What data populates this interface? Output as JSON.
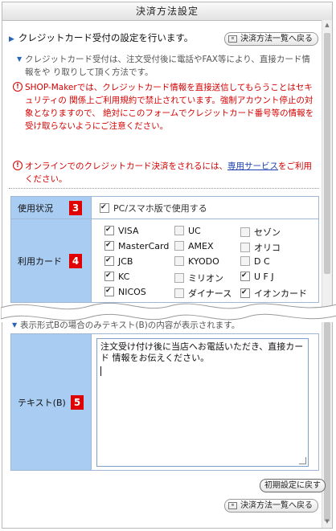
{
  "window": {
    "title": "決済方法設定"
  },
  "header": {
    "text": "クレジットカード受付の設定を行います。",
    "back_button_top": "決済方法一覧へ戻る"
  },
  "notes": {
    "info": "クレジットカード受付は、注文受付後に電話やFAX等により、直接カード情報をや り取りして頂く方法です。",
    "warning1": "SHOP-Makerでは、クレジットカード情報を直接送信してもらうことはセキュリティの 関係上ご利用規約で禁止されています。強制アカウント停止の対象となりますので、 絶対にこのフォームでクレジットカード番号等の情報を受け取らないようにご注意ください。",
    "warning2_prefix": "オンラインでのクレジットカード決済をされるには、",
    "warning2_link": "専用サービス",
    "warning2_suffix": "をご利用ください。"
  },
  "usage": {
    "label": "使用状況",
    "badge": "3",
    "checkbox_label": "PC/スマホ版で使用する",
    "checked": true
  },
  "cards": {
    "label": "利用カード",
    "badge": "4",
    "items": [
      {
        "name": "VISA",
        "checked": true
      },
      {
        "name": "UC",
        "checked": false
      },
      {
        "name": "セゾン",
        "checked": false
      },
      {
        "name": "MasterCard",
        "checked": true
      },
      {
        "name": "AMEX",
        "checked": false
      },
      {
        "name": "オリコ",
        "checked": false
      },
      {
        "name": "JCB",
        "checked": true
      },
      {
        "name": "KYODO",
        "checked": false
      },
      {
        "name": "D C",
        "checked": false
      },
      {
        "name": "KC",
        "checked": true
      },
      {
        "name": "ミリオン",
        "checked": false
      },
      {
        "name": "U F J",
        "checked": true
      },
      {
        "name": "NICOS",
        "checked": true
      },
      {
        "name": "ダイナース",
        "checked": false
      },
      {
        "name": "イオンカード",
        "checked": true
      }
    ]
  },
  "text_b": {
    "note": "表示形式Bの場合のみテキスト(B)の内容が表示されます。",
    "label": "テキスト(B)",
    "badge": "5",
    "value": "注文受け付け後に当店へお電話いただき、直接カード 情報をお伝えください。"
  },
  "buttons": {
    "reset": "初期設定に戻す",
    "back_bottom": "決済方法一覧へ戻る"
  },
  "colors": {
    "label_bg": "#a9cdf2",
    "badge": "#e00000",
    "warning": "#d40000",
    "link": "#1a3fb0"
  }
}
